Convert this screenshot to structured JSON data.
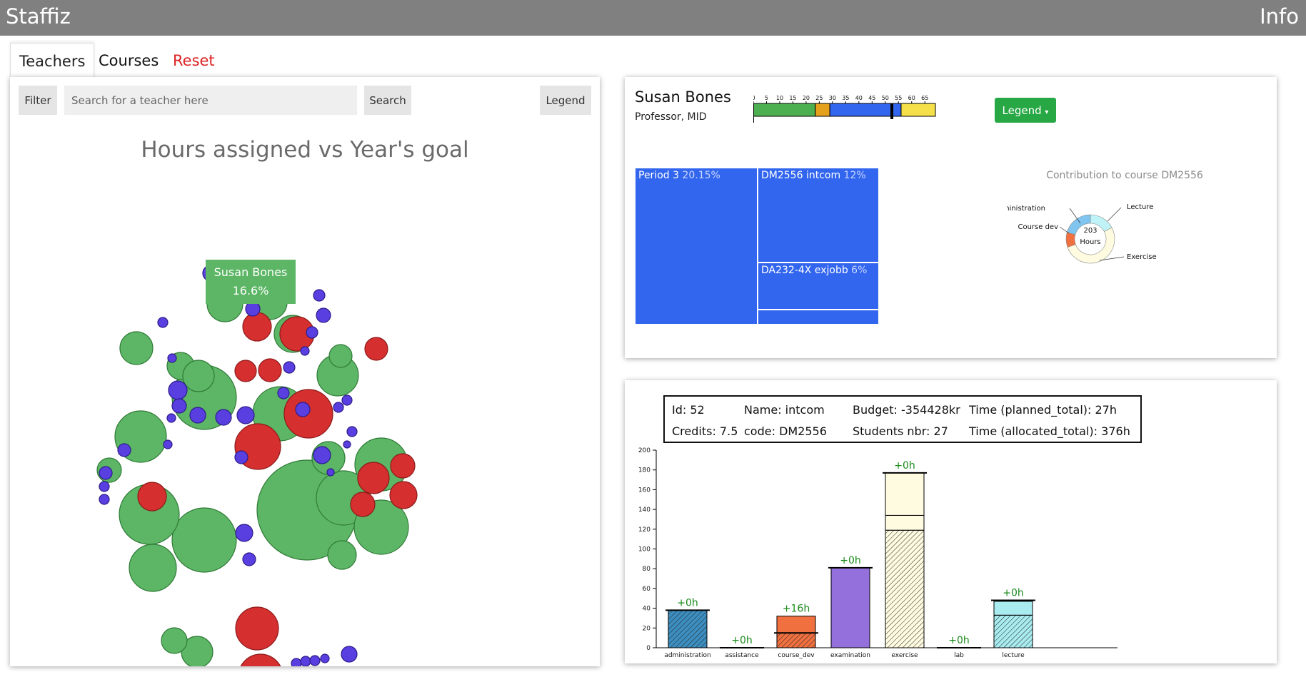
{
  "app": {
    "brand": "Staffiz",
    "info_label": "Info"
  },
  "tabs": [
    {
      "label": "Teachers",
      "active": true,
      "color": "#111111"
    },
    {
      "label": "Courses",
      "active": false,
      "color": "#111111"
    },
    {
      "label": "Reset",
      "active": false,
      "color": "#dd2222"
    }
  ],
  "teacher_panel": {
    "filter_label": "Filter",
    "search_placeholder": "Search for a teacher here",
    "search_label": "Search",
    "legend_label": "Legend",
    "chart_title": "Hours assigned vs Year's goal",
    "tooltip": {
      "name": "Susan Bones",
      "value": "16.6%"
    }
  },
  "colors": {
    "green": "#5cb665",
    "red": "#d62f2f",
    "purple": "#5a3fe0",
    "blue": "#3366ee"
  },
  "teacher_detail": {
    "name": "Susan Bones",
    "role": "Professor, MID",
    "legend_label": "Legend",
    "hours_bar": {
      "ticks": [
        "0",
        "5",
        "10",
        "15",
        "20",
        "25",
        "30",
        "35",
        "40",
        "45",
        "50",
        "55",
        "60",
        "65"
      ],
      "segments": [
        {
          "from": 0,
          "to": 23.5,
          "color": "#4caf50"
        },
        {
          "from": 23.5,
          "to": 29,
          "color": "#e5a11c"
        },
        {
          "from": 29,
          "to": 56,
          "color": "#3366ee"
        },
        {
          "from": 56,
          "to": 69,
          "color": "#f5e04a"
        }
      ],
      "marker": 52.5,
      "max": 69
    },
    "treemap": [
      {
        "label": "Period 3",
        "pct": "20.15%"
      },
      {
        "label": "DM2556 intcom",
        "pct": "12%"
      },
      {
        "label": "DA232-4X exjobb",
        "pct": "6%"
      }
    ],
    "donut": {
      "title": "Contribution to course DM2556",
      "center_value": "203",
      "center_unit": "Hours",
      "labels": [
        "Administration",
        "Lecture",
        "Course dev",
        "Exercise"
      ]
    }
  },
  "course_info": {
    "id": "Id: 52",
    "name": "Name: intcom",
    "budget": "Budget: -354428kr",
    "time_planned": "Time (planned_total): 27h",
    "credits": "Credits: 7.5",
    "code": "code: DM2556",
    "students": "Students nbr: 27",
    "time_allocated": "Time (allocated_total): 376h"
  },
  "chart_data": {
    "type": "bar",
    "categories": [
      "administration",
      "assistance",
      "course_dev",
      "examination",
      "exercise",
      "lab",
      "lecture"
    ],
    "series": [
      {
        "values": [
          38,
          0,
          15,
          81,
          119,
          0,
          33
        ]
      },
      {
        "values": [
          0,
          0,
          17,
          0,
          15,
          0,
          14
        ]
      },
      {
        "values": [
          0,
          0,
          0,
          0,
          43,
          0,
          0
        ]
      }
    ],
    "planned": [
      38,
      0,
      15,
      81,
      177,
      0,
      48
    ],
    "labels": [
      "+0h",
      "+0h",
      "+16h",
      "+0h",
      "+0h",
      "+0h",
      "+0h"
    ],
    "yticks": [
      "0",
      "20",
      "40",
      "60",
      "80",
      "100",
      "120",
      "140",
      "160",
      "180",
      "200"
    ],
    "ylim": [
      0,
      200
    ],
    "colors": [
      "#3c8ec0",
      "#ffffff",
      "#f07040",
      "#9370db",
      "#fffbe0",
      "#ffffff",
      "#a8ecf0"
    ]
  }
}
